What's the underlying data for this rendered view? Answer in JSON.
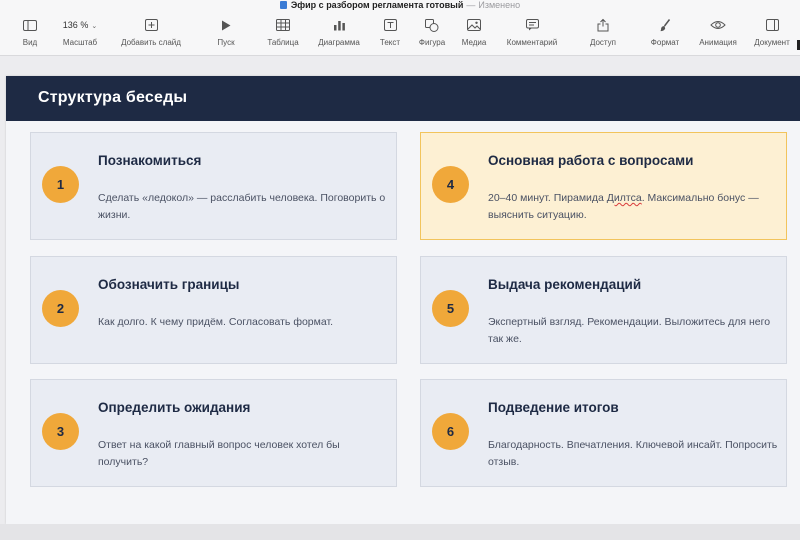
{
  "window": {
    "title": "Эфир с разбором регламента готовый",
    "separator": "—",
    "status": "Изменено"
  },
  "toolbar": {
    "view": {
      "label": "Вид",
      "icon": "sidebar-icon"
    },
    "zoom": {
      "label": "Масштаб",
      "value": "136 %"
    },
    "add_slide": {
      "label": "Добавить слайд",
      "icon": "add-slide-icon"
    },
    "play": {
      "label": "Пуск",
      "icon": "play-icon"
    },
    "table": {
      "label": "Таблица",
      "icon": "table-icon"
    },
    "chart": {
      "label": "Диаграмма",
      "icon": "chart-icon"
    },
    "text": {
      "label": "Текст",
      "icon": "text-icon"
    },
    "shape": {
      "label": "Фигура",
      "icon": "shape-icon"
    },
    "media": {
      "label": "Медиа",
      "icon": "media-icon"
    },
    "comment": {
      "label": "Комментарий",
      "icon": "comment-icon"
    },
    "share": {
      "label": "Доступ",
      "icon": "share-icon"
    },
    "format": {
      "label": "Формат",
      "icon": "brush-icon"
    },
    "animate": {
      "label": "Анимация",
      "icon": "animation-icon"
    },
    "document": {
      "label": "Документ",
      "icon": "document-icon"
    }
  },
  "slide": {
    "title": "Структура беседы",
    "cards": [
      {
        "number": "1",
        "title": "Познакомиться",
        "desc": "Сделать «ледокол» — расслабить человека. Поговорить о жизни."
      },
      {
        "number": "2",
        "title": "Обозначить границы",
        "desc": "Как долго. К чему придём. Согласовать формат."
      },
      {
        "number": "3",
        "title": "Определить ожидания",
        "desc": "Ответ на какой главный вопрос человек хотел бы получить?"
      },
      {
        "number": "4",
        "title": "Основная работа с вопросами",
        "desc_before": "20–40 минут. Пирамида ",
        "desc_spell": "Дилтса",
        "desc_after": ". Максимально бонус — выяснить ситуацию."
      },
      {
        "number": "5",
        "title": "Выдача рекомендаций",
        "desc": "Экспертный взгляд. Рекомендации. Выложитесь для него так же."
      },
      {
        "number": "6",
        "title": "Подведение итогов",
        "desc": "Благодарность. Впечатления. Ключевой инсайт. Попросить отзыв."
      }
    ]
  },
  "colors": {
    "header": "#1e2a44",
    "badge": "#f0a83a",
    "card": "#e9ecf3",
    "card_highlight": "#fdf0d3",
    "highlight_border": "#f2c45c"
  }
}
